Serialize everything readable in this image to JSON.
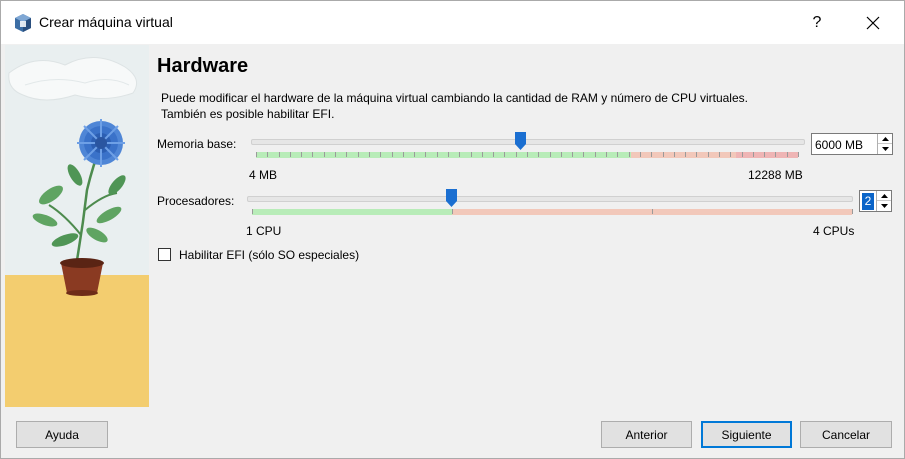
{
  "window": {
    "title": "Crear máquina virtual",
    "help_label": "?"
  },
  "page": {
    "heading": "Hardware",
    "description_line1": "Puede modificar el hardware de la máquina virtual cambiando la cantidad de RAM y número de CPU virtuales.",
    "description_line2": "También es posible habilitar EFI."
  },
  "memory": {
    "label": "Memoria base:",
    "value": "6000 MB",
    "min_label": "4 MB",
    "max_label": "12288 MB",
    "fraction": 0.488
  },
  "cpu": {
    "label": "Procesadores:",
    "value": "2",
    "min_label": "1 CPU",
    "max_label": "4 CPUs",
    "fraction": 0.333
  },
  "efi": {
    "label": "Habilitar EFI (sólo SO especiales)",
    "checked": false
  },
  "buttons": {
    "help": "Ayuda",
    "back": "Anterior",
    "next": "Siguiente",
    "cancel": "Cancelar"
  },
  "colors": {
    "zone_green": "#b8ecb8",
    "zone_red": "#f2c8ba",
    "zone_deep_red": "#efb5b5",
    "accent": "#0078d7",
    "handle": "#1b6fd1"
  }
}
